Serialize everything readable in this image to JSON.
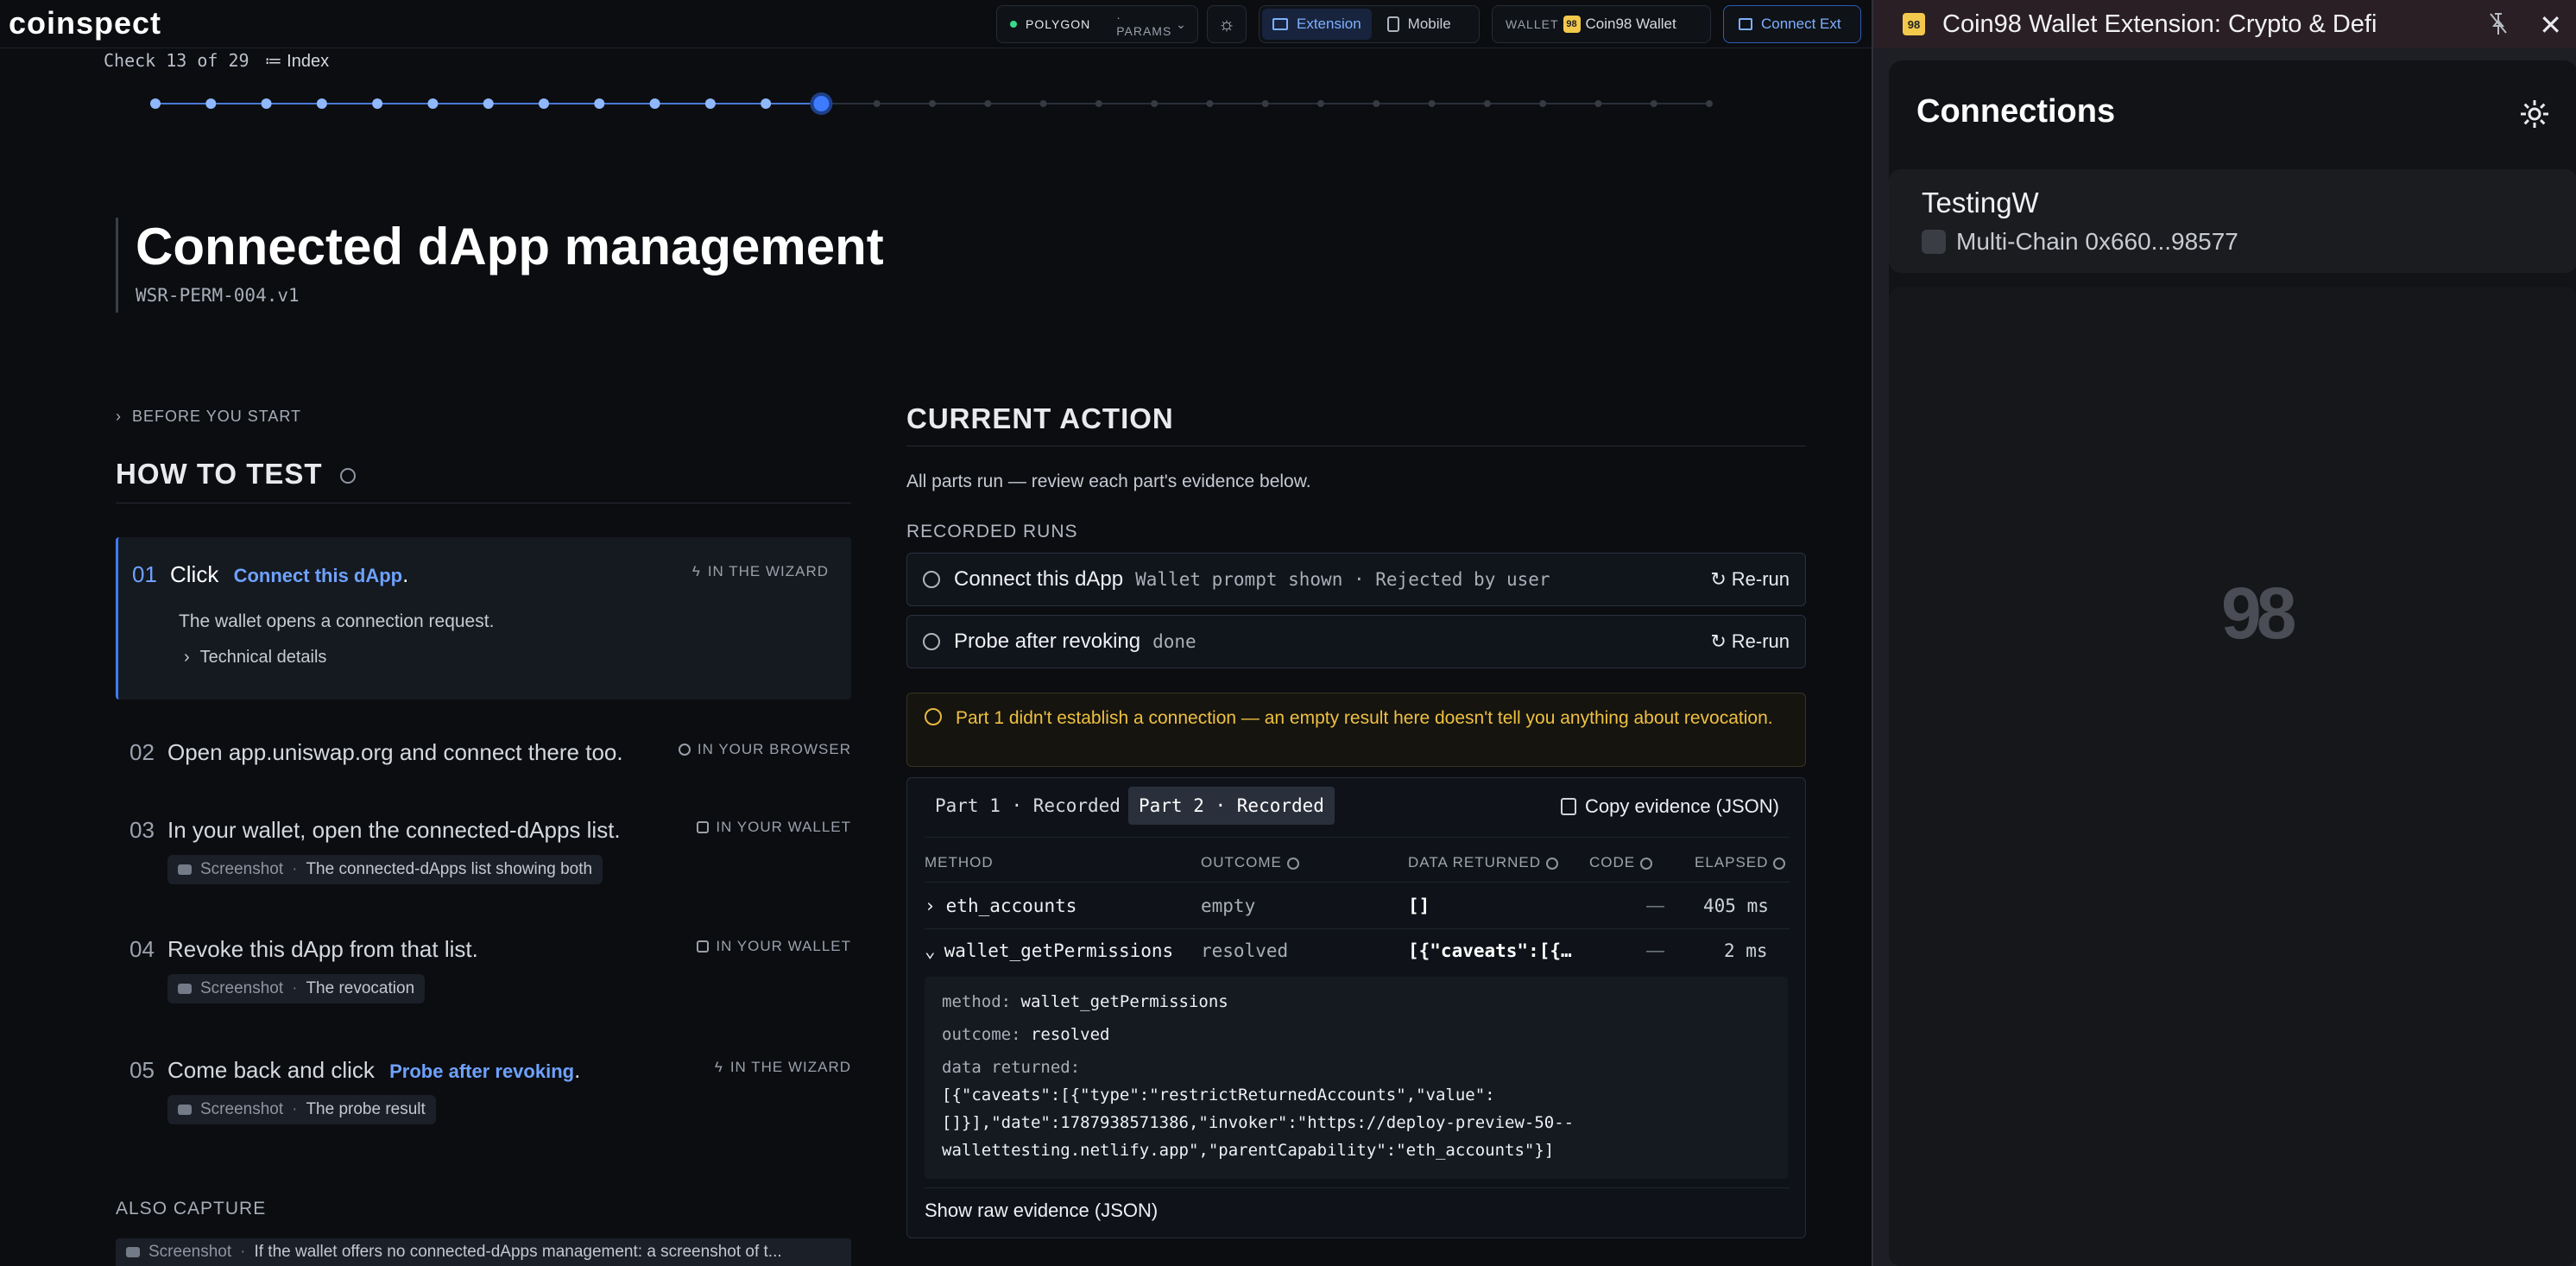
{
  "topbar": {
    "logo": "coinspect",
    "network": "POLYGON",
    "params": "· PARAMS",
    "mode_extension": "Extension",
    "mode_mobile": "Mobile",
    "wallet_label": "WALLET",
    "wallet_name": "Coin98 Wallet",
    "connect_ext": "Connect Ext"
  },
  "progress": {
    "label": "Check 13 of 29",
    "index_label": "Index",
    "current": 13,
    "total": 29
  },
  "page": {
    "title": "Connected dApp management",
    "code": "WSR-PERM-004.v1"
  },
  "how_to": {
    "before_label": "BEFORE YOU START",
    "heading": "HOW TO TEST",
    "steps": [
      {
        "num": "01",
        "pre": "Click",
        "link": "Connect this dApp",
        "post": ".",
        "where": "IN THE WIZARD",
        "desc": "The wallet opens a connection request.",
        "tech": "Technical details"
      },
      {
        "num": "02",
        "text": "Open app.uniswap.org and connect there too.",
        "where": "IN YOUR BROWSER"
      },
      {
        "num": "03",
        "text": "In your wallet, open the connected-dApps list.",
        "where": "IN YOUR WALLET",
        "chip_label": "Screenshot",
        "chip_text": "The connected-dApps list showing both"
      },
      {
        "num": "04",
        "text": "Revoke this dApp from that list.",
        "where": "IN YOUR WALLET",
        "chip_label": "Screenshot",
        "chip_text": "The revocation"
      },
      {
        "num": "05",
        "pre": "Come back and click",
        "link": "Probe after revoking",
        "post": ".",
        "where": "IN THE WIZARD",
        "chip_label": "Screenshot",
        "chip_text": "The probe result"
      }
    ],
    "also_capture": "ALSO CAPTURE",
    "also_chip_label": "Screenshot",
    "also_chip_text": "If the wallet offers no connected-dApps management: a screenshot of t..."
  },
  "current_action": {
    "heading": "CURRENT ACTION",
    "summary": "All parts run — review each part's evidence below.",
    "recorded_label": "RECORDED RUNS",
    "runs": [
      {
        "name": "Connect this dApp",
        "meta": "Wallet prompt shown · Rejected by user",
        "action": "Re-run"
      },
      {
        "name": "Probe after revoking",
        "meta": "done",
        "action": "Re-run"
      }
    ],
    "warning": "Part 1 didn't establish a connection — an empty result here doesn't tell you anything about revocation.",
    "tabs": [
      "Part 1 · Recorded",
      "Part 2 · Recorded"
    ],
    "copy_label": "Copy evidence (JSON)",
    "columns": [
      "METHOD",
      "OUTCOME",
      "DATA RETURNED",
      "CODE",
      "ELAPSED"
    ],
    "rows": [
      {
        "method": "eth_accounts",
        "outcome": "empty",
        "data": "[]",
        "code": "—",
        "elapsed": "405 ms"
      },
      {
        "method": "wallet_getPermissions",
        "outcome": "resolved",
        "data": "[{\"caveats\":[{…",
        "code": "—",
        "elapsed": "2 ms"
      }
    ],
    "detail": {
      "method_key": "method:",
      "method_val": "wallet_getPermissions",
      "outcome_key": "outcome:",
      "outcome_val": "resolved",
      "data_key": "data returned:",
      "line1": "[{\"caveats\":[{\"type\":\"restrictReturnedAccounts\",\"value\":",
      "line2": "[]}],\"date\":1787938571386,\"invoker\":\"https://deploy-preview-50--",
      "line3": "wallettesting.netlify.app\",\"parentCapability\":\"eth_accounts\"}]"
    },
    "raw_link": "Show raw evidence (JSON)"
  },
  "wallet": {
    "title": "Coin98 Wallet Extension: Crypto & Defi",
    "badge": "98",
    "connections_title": "Connections",
    "dapp_name": "TestingW",
    "dapp_chain": "Multi-Chain 0x660...98577",
    "watermark": "98"
  }
}
